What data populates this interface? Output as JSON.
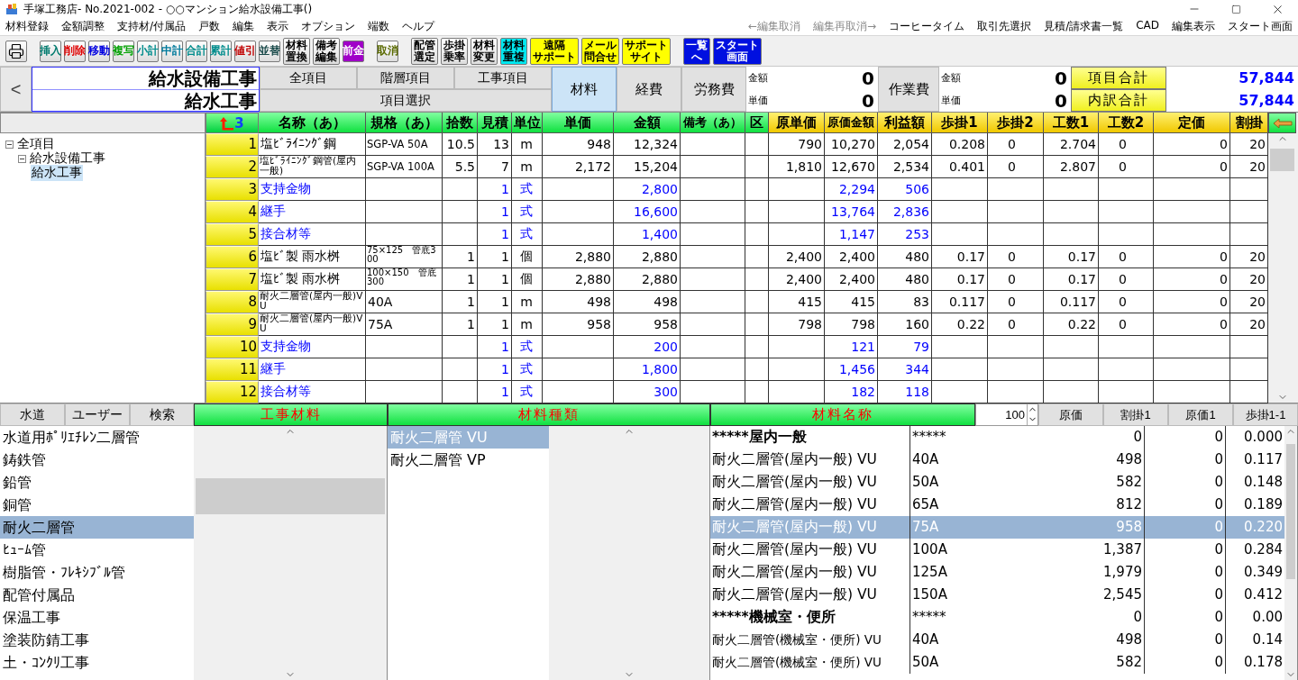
{
  "window": {
    "title": "手塚工務店- No.2021-002 - ○○マンション給水設備工事()"
  },
  "menu": {
    "left": [
      "材料登録",
      "金額調整",
      "支持材/付属品",
      "戸数",
      "編集",
      "表示",
      "オプション",
      "端数",
      "ヘルプ"
    ],
    "right": [
      {
        "label": "←編集取消",
        "disabled": true
      },
      {
        "label": "編集再取消→",
        "disabled": true
      },
      {
        "label": "コーヒータイム",
        "disabled": false
      },
      {
        "label": "取引先選択",
        "disabled": false
      },
      {
        "label": "見積/請求書一覧",
        "disabled": false
      },
      {
        "label": "CAD",
        "disabled": false
      },
      {
        "label": "編集表示",
        "disabled": false
      },
      {
        "label": "スタート画面",
        "disabled": false
      }
    ]
  },
  "toolbar": [
    {
      "buttons": [
        {
          "kind": "print"
        }
      ]
    },
    {
      "buttons": [
        {
          "kind": "normal",
          "label": "挿入",
          "color": "#007a6e"
        },
        {
          "kind": "normal",
          "label": "削除",
          "color": "#e00000"
        },
        {
          "kind": "normal",
          "label": "移動",
          "color": "#0000e0"
        },
        {
          "kind": "normal",
          "label": "複写",
          "color": "#00a000"
        },
        {
          "kind": "normal",
          "label": "小計",
          "color": "#008c8c"
        },
        {
          "kind": "normal",
          "label": "中計",
          "color": "#007a9c"
        },
        {
          "kind": "normal",
          "label": "合計",
          "color": "#008c8c"
        },
        {
          "kind": "normal",
          "label": "累計",
          "color": "#008c8c"
        },
        {
          "kind": "normal",
          "label": "値引",
          "color": "#c00000"
        },
        {
          "kind": "normal",
          "label": "並替",
          "color": "#1a4a4a"
        },
        {
          "kind": "normal",
          "lines": [
            "材料",
            "置換"
          ],
          "color": "#000000"
        },
        {
          "kind": "normal",
          "lines": [
            "備考",
            "編集"
          ],
          "color": "#000000"
        },
        {
          "kind": "advance",
          "label": "前金"
        }
      ]
    },
    {
      "buttons": [
        {
          "kind": "normal",
          "label": "取消",
          "color": "#5a6a00"
        }
      ]
    },
    {
      "buttons": [
        {
          "kind": "normal",
          "lines": [
            "配管",
            "選定"
          ],
          "color": "#000000"
        },
        {
          "kind": "normal",
          "lines": [
            "歩掛",
            "乗率"
          ],
          "color": "#000000"
        },
        {
          "kind": "normal",
          "lines": [
            "材料",
            "変更"
          ],
          "color": "#000000"
        },
        {
          "kind": "duplicate",
          "lines": [
            "材料",
            "重複"
          ]
        },
        {
          "kind": "support",
          "lines": [
            "遠隔",
            "サポート"
          ]
        },
        {
          "kind": "support",
          "lines": [
            "メール",
            "問合せ"
          ]
        },
        {
          "kind": "support",
          "lines": [
            "サポート",
            "サイト"
          ]
        }
      ]
    },
    {
      "buttons": [
        {
          "kind": "nav",
          "lines": [
            "一覧",
            "へ"
          ]
        },
        {
          "kind": "nav",
          "lines": [
            "スタート",
            "画面"
          ]
        }
      ]
    }
  ],
  "header": {
    "back": "<",
    "titles": [
      "給水設備工事",
      "給水工事"
    ],
    "scope_tabs": [
      {
        "label": "全項目",
        "selected": false
      },
      {
        "label": "階層項目",
        "selected": false
      },
      {
        "label": "工事項目",
        "selected": false
      }
    ],
    "item_select": "項目選択",
    "category_tabs": [
      {
        "label": "材料",
        "selected": true
      },
      {
        "label": "経費",
        "selected": false
      },
      {
        "label": "労務費",
        "selected": false
      }
    ],
    "labor_figures": [
      {
        "label": "金額",
        "value": "0"
      },
      {
        "label": "単価",
        "value": "0"
      }
    ],
    "work_button": "作業費",
    "work_figures": [
      {
        "label": "金額",
        "value": "0"
      },
      {
        "label": "単価",
        "value": "0"
      }
    ],
    "totals": [
      {
        "label": "項目合計",
        "value": "57,844"
      },
      {
        "label": "内訳合計",
        "value": "57,844"
      }
    ]
  },
  "tree": [
    {
      "label": "全項目",
      "expanded": true,
      "selected": false,
      "children": [
        {
          "label": "給水設備工事",
          "expanded": true,
          "selected": false,
          "children": [
            {
              "label": "給水工事",
              "selected": true
            }
          ]
        }
      ]
    }
  ],
  "grid": {
    "corner": "3",
    "columns": [
      {
        "label": "名称（あ）",
        "kind": "sales"
      },
      {
        "label": "規格（あ）",
        "kind": "sales"
      },
      {
        "label": "拾数",
        "kind": "sales"
      },
      {
        "label": "見積",
        "kind": "sales"
      },
      {
        "label": "単位",
        "kind": "sales"
      },
      {
        "label": "単価",
        "kind": "sales"
      },
      {
        "label": "金額",
        "kind": "sales"
      },
      {
        "label": "備考（あ）",
        "kind": "sales"
      },
      {
        "label": "区",
        "kind": "sales"
      },
      {
        "label": "原単価",
        "kind": "cost"
      },
      {
        "label": "原価金額",
        "kind": "cost"
      },
      {
        "label": "利益額",
        "kind": "cost"
      },
      {
        "label": "歩掛1",
        "kind": "cost"
      },
      {
        "label": "歩掛2",
        "kind": "cost"
      },
      {
        "label": "工数1",
        "kind": "cost"
      },
      {
        "label": "工数2",
        "kind": "cost"
      },
      {
        "label": "定価",
        "kind": "cost"
      },
      {
        "label": "割掛",
        "kind": "cost"
      }
    ],
    "rows": [
      {
        "no": "1",
        "kind": "item",
        "name": "塩ﾋﾞﾗｲﾆﾝｸﾞ鋼",
        "spec": "SGP-VA 50A",
        "count": "10.5",
        "estimate": "13",
        "unit": "m",
        "unit_price": "948",
        "amount": "12,324",
        "cost_unit": "790",
        "cost_amount": "10,270",
        "profit": "2,054",
        "labor_rate_1": "0.208",
        "labor_rate_2": "0",
        "man_hours_1": "2.704",
        "man_hours_2": "0",
        "list_price": "0",
        "markup": "20"
      },
      {
        "no": "2",
        "kind": "item",
        "name": "塩ﾋﾞﾗｲﾆﾝｸﾞ鋼管(屋内一般)",
        "spec": "SGP-VA 100A",
        "count": "5.5",
        "estimate": "7",
        "unit": "m",
        "unit_price": "2,172",
        "amount": "15,204",
        "cost_unit": "1,810",
        "cost_amount": "12,670",
        "profit": "2,534",
        "labor_rate_1": "0.401",
        "labor_rate_2": "0",
        "man_hours_1": "2.807",
        "man_hours_2": "0",
        "list_price": "0",
        "markup": "20"
      },
      {
        "no": "3",
        "kind": "group",
        "name": "支持金物",
        "estimate": "1",
        "unit": "式",
        "amount": "2,800",
        "cost_amount": "2,294",
        "profit": "506"
      },
      {
        "no": "4",
        "kind": "group",
        "name": "継手",
        "estimate": "1",
        "unit": "式",
        "amount": "16,600",
        "cost_amount": "13,764",
        "profit": "2,836"
      },
      {
        "no": "5",
        "kind": "group",
        "name": "接合材等",
        "estimate": "1",
        "unit": "式",
        "amount": "1,400",
        "cost_amount": "1,147",
        "profit": "253"
      },
      {
        "no": "6",
        "kind": "item",
        "name": "塩ﾋﾞ製 雨水桝",
        "spec": "75×125　管底300",
        "count": "1",
        "estimate": "1",
        "unit": "個",
        "unit_price": "2,880",
        "amount": "2,880",
        "cost_unit": "2,400",
        "cost_amount": "2,400",
        "profit": "480",
        "labor_rate_1": "0.17",
        "labor_rate_2": "0",
        "man_hours_1": "0.17",
        "man_hours_2": "0",
        "list_price": "0",
        "markup": "20"
      },
      {
        "no": "7",
        "kind": "item",
        "name": "塩ﾋﾞ製 雨水桝",
        "spec": "100×150　管底300",
        "count": "1",
        "estimate": "1",
        "unit": "個",
        "unit_price": "2,880",
        "amount": "2,880",
        "cost_unit": "2,400",
        "cost_amount": "2,400",
        "profit": "480",
        "labor_rate_1": "0.17",
        "labor_rate_2": "0",
        "man_hours_1": "0.17",
        "man_hours_2": "0",
        "list_price": "0",
        "markup": "20"
      },
      {
        "no": "8",
        "kind": "item",
        "name": "耐火二層管(屋内一般)VU",
        "spec": "40A",
        "count": "1",
        "estimate": "1",
        "unit": "m",
        "unit_price": "498",
        "amount": "498",
        "cost_unit": "415",
        "cost_amount": "415",
        "profit": "83",
        "labor_rate_1": "0.117",
        "labor_rate_2": "0",
        "man_hours_1": "0.117",
        "man_hours_2": "0",
        "list_price": "0",
        "markup": "20"
      },
      {
        "no": "9",
        "kind": "item",
        "name": "耐火二層管(屋内一般)VU",
        "spec": "75A",
        "count": "1",
        "estimate": "1",
        "unit": "m",
        "unit_price": "958",
        "amount": "958",
        "cost_unit": "798",
        "cost_amount": "798",
        "profit": "160",
        "labor_rate_1": "0.22",
        "labor_rate_2": "0",
        "man_hours_1": "0.22",
        "man_hours_2": "0",
        "list_price": "0",
        "markup": "20"
      },
      {
        "no": "10",
        "kind": "group",
        "name": "支持金物",
        "estimate": "1",
        "unit": "式",
        "amount": "200",
        "cost_amount": "121",
        "profit": "79"
      },
      {
        "no": "11",
        "kind": "group",
        "name": "継手",
        "estimate": "1",
        "unit": "式",
        "amount": "1,800",
        "cost_amount": "1,456",
        "profit": "344"
      },
      {
        "no": "12",
        "kind": "group",
        "name": "接合材等",
        "estimate": "1",
        "unit": "式",
        "amount": "300",
        "cost_amount": "182",
        "profit": "118"
      }
    ]
  },
  "bottom_bar": {
    "tabs": [
      "水道",
      "ユーザー",
      "検索"
    ],
    "headers": [
      "工事材料",
      "材料種類",
      "材料名称"
    ],
    "quantity": "100",
    "buttons": [
      "原価",
      "割掛1",
      "原価1",
      "歩掛1-1"
    ]
  },
  "construction_materials": [
    {
      "label": "水道用ﾎﾟﾘｴﾁﾚﾝ二層管",
      "selected": false
    },
    {
      "label": "鋳鉄管",
      "selected": false
    },
    {
      "label": "鉛管",
      "selected": false
    },
    {
      "label": "銅管",
      "selected": false
    },
    {
      "label": "耐火二層管",
      "selected": true
    },
    {
      "label": "ﾋｭｰﾑ管",
      "selected": false
    },
    {
      "label": "樹脂管・ﾌﾚｷｼﾌﾞﾙ管",
      "selected": false
    },
    {
      "label": "配管付属品",
      "selected": false
    },
    {
      "label": "保温工事",
      "selected": false
    },
    {
      "label": "塗装防錆工事",
      "selected": false
    },
    {
      "label": "土・ｺﾝｸﾘ工事",
      "selected": false
    }
  ],
  "material_types": [
    {
      "label": "耐火二層管 VU",
      "selected": true
    },
    {
      "label": "耐火二層管 VP",
      "selected": false
    }
  ],
  "material_names": [
    {
      "kind": "heading",
      "name": "*****屋内一般",
      "spec": "*****",
      "price": "0",
      "markup": "0",
      "rate": "0.000",
      "selected": false
    },
    {
      "kind": "item",
      "name": "耐火二層管(屋内一般) VU",
      "spec": "40A",
      "price": "498",
      "markup": "0",
      "rate": "0.117",
      "selected": false
    },
    {
      "kind": "item",
      "name": "耐火二層管(屋内一般) VU",
      "spec": "50A",
      "price": "582",
      "markup": "0",
      "rate": "0.148",
      "selected": false
    },
    {
      "kind": "item",
      "name": "耐火二層管(屋内一般) VU",
      "spec": "65A",
      "price": "812",
      "markup": "0",
      "rate": "0.189",
      "selected": false
    },
    {
      "kind": "item",
      "name": "耐火二層管(屋内一般) VU",
      "spec": "75A",
      "price": "958",
      "markup": "0",
      "rate": "0.220",
      "selected": true
    },
    {
      "kind": "item",
      "name": "耐火二層管(屋内一般) VU",
      "spec": "100A",
      "price": "1,387",
      "markup": "0",
      "rate": "0.284",
      "selected": false
    },
    {
      "kind": "item",
      "name": "耐火二層管(屋内一般) VU",
      "spec": "125A",
      "price": "1,979",
      "markup": "0",
      "rate": "0.349",
      "selected": false
    },
    {
      "kind": "item",
      "name": "耐火二層管(屋内一般) VU",
      "spec": "150A",
      "price": "2,545",
      "markup": "0",
      "rate": "0.412",
      "selected": false
    },
    {
      "kind": "heading",
      "name": "*****機械室・便所",
      "spec": "*****",
      "price": "0",
      "markup": "0",
      "rate": "0.00",
      "selected": false
    },
    {
      "kind": "item",
      "name": "耐火二層管(機械室・便所) VU",
      "spec": "40A",
      "price": "498",
      "markup": "0",
      "rate": "0.14",
      "selected": false
    },
    {
      "kind": "item",
      "name": "耐火二層管(機械室・便所) VU",
      "spec": "50A",
      "price": "582",
      "markup": "0",
      "rate": "0.178",
      "selected": false
    }
  ]
}
